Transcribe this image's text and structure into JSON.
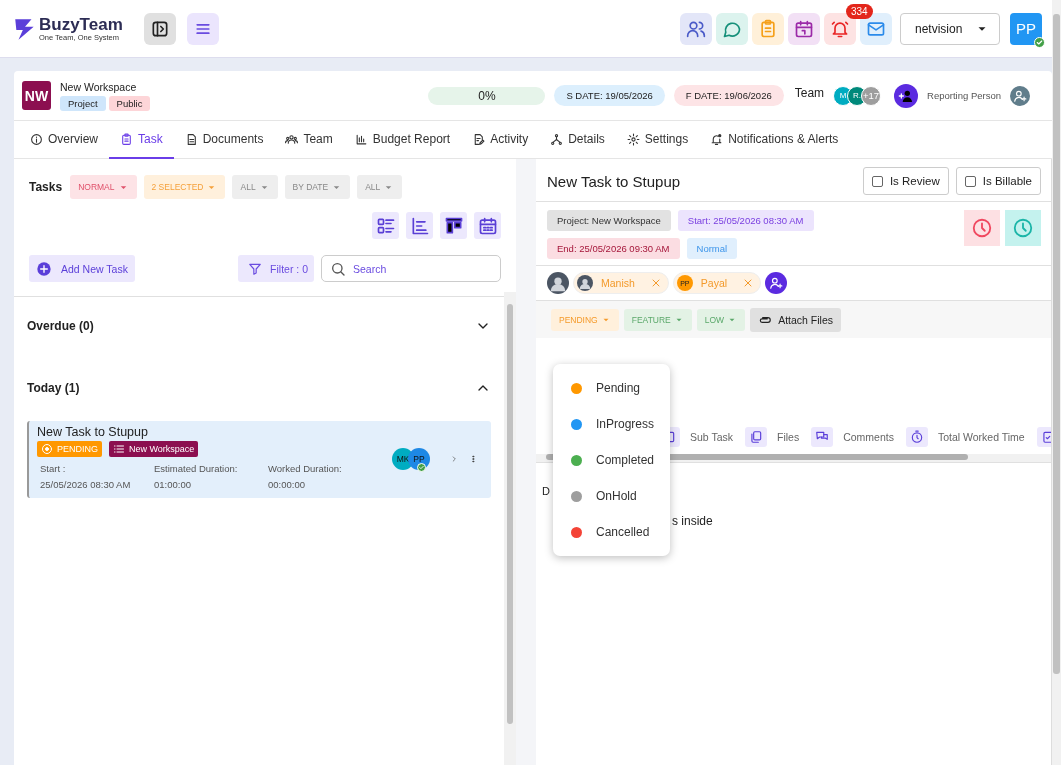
{
  "brand": {
    "name": "BuzyTeam",
    "tagline": "One Team, One System"
  },
  "notifications_badge": "334",
  "org_select": {
    "value": "netvision"
  },
  "user_avatar": {
    "initials": "PP"
  },
  "workspace": {
    "initials": "NW",
    "name": "New Workspace",
    "tags": [
      {
        "label": "Project",
        "color": "#cfe6fb"
      },
      {
        "label": "Public",
        "color": "#fdd5d8"
      }
    ]
  },
  "progress": {
    "label": "0%",
    "level": 0
  },
  "dates": [
    {
      "label": "S DATE: 19/05/2026",
      "kind": "start"
    },
    {
      "label": "F DATE: 19/06/2026",
      "kind": "finish"
    }
  ],
  "team": {
    "label": "Team",
    "members": [
      {
        "initials": "M",
        "color": "#00acc1"
      },
      {
        "initials": "R.",
        "color": "#00897b"
      },
      {
        "initials": "+17",
        "color": "#9e9e9e"
      }
    ]
  },
  "reporting_person": "Reporting Person",
  "tabs": [
    {
      "label": "Overview",
      "selected": false
    },
    {
      "label": "Task",
      "selected": true
    },
    {
      "label": "Documents",
      "selected": false
    },
    {
      "label": "Team",
      "selected": false
    },
    {
      "label": "Budget Report",
      "selected": false
    },
    {
      "label": "Activity",
      "selected": false
    },
    {
      "label": "Details",
      "selected": false
    },
    {
      "label": "Settings",
      "selected": false
    },
    {
      "label": "Notifications & Alerts",
      "selected": false
    }
  ],
  "tasks_panel": {
    "title": "Tasks",
    "filters": [
      {
        "label": "NORMAL",
        "kind": "priority"
      },
      {
        "label": "2 SELECTED",
        "kind": "status"
      },
      {
        "label": "ALL",
        "kind": "plain"
      },
      {
        "label": "BY DATE",
        "kind": "plain"
      },
      {
        "label": "ALL",
        "kind": "plain"
      }
    ],
    "add_button": "Add New Task",
    "filter_button": "Filter : 0",
    "search": {
      "placeholder": "Search"
    },
    "groups": [
      {
        "title": "Overdue (0)",
        "expanded": false
      },
      {
        "title": "Today (1)",
        "expanded": true,
        "tasks": [
          {
            "title": "New Task to Stupup",
            "status": "PENDING",
            "project": "New Workspace",
            "selected": true,
            "fields": [
              {
                "label": "Start :",
                "value": "25/05/2026 08:30 AM"
              },
              {
                "label": "Estimated Duration:",
                "value": "01:00:00"
              },
              {
                "label": "Worked Duration:",
                "value": "00:00:00"
              }
            ],
            "assignees": [
              {
                "initials": "MK",
                "color": "#00acc1"
              },
              {
                "initials": "PP",
                "color": "#1e88e5"
              }
            ]
          }
        ]
      }
    ]
  },
  "detail": {
    "title": "New Task to Stupup",
    "checks": [
      {
        "label": "Is Review",
        "checked": false
      },
      {
        "label": "Is Billable",
        "checked": false
      }
    ],
    "chips": [
      {
        "label": "Project:  New Workspace",
        "kind": "project"
      },
      {
        "label": "Start:  25/05/2026 08:30 AM",
        "kind": "start"
      },
      {
        "label": "End:  25/05/2026 09:30 AM",
        "kind": "end"
      },
      {
        "label": "Normal",
        "kind": "priority"
      }
    ],
    "assignees": [
      {
        "name": "Manish",
        "kind": "photo"
      },
      {
        "name": "Payal",
        "initials": "PP",
        "kind": "initials"
      }
    ],
    "status_chips": [
      {
        "label": "PENDING",
        "kind": "status"
      },
      {
        "label": "FEATURE",
        "kind": "type"
      },
      {
        "label": "LOW",
        "kind": "priority"
      }
    ],
    "attach_button": "Attach Files",
    "status_menu": {
      "expanded": true,
      "options": [
        {
          "label": "Pending",
          "color": "#ff9800"
        },
        {
          "label": "InProgress",
          "color": "#2196f3"
        },
        {
          "label": "Completed",
          "color": "#4caf50"
        },
        {
          "label": "OnHold",
          "color": "#9e9e9e"
        },
        {
          "label": "Cancelled",
          "color": "#f44336"
        }
      ]
    },
    "sections": [
      {
        "label": "Sub Task"
      },
      {
        "label": "Files"
      },
      {
        "label": "Comments"
      },
      {
        "label": "Total Worked Time"
      }
    ],
    "description": {
      "label": "D",
      "text": "s inside"
    }
  }
}
